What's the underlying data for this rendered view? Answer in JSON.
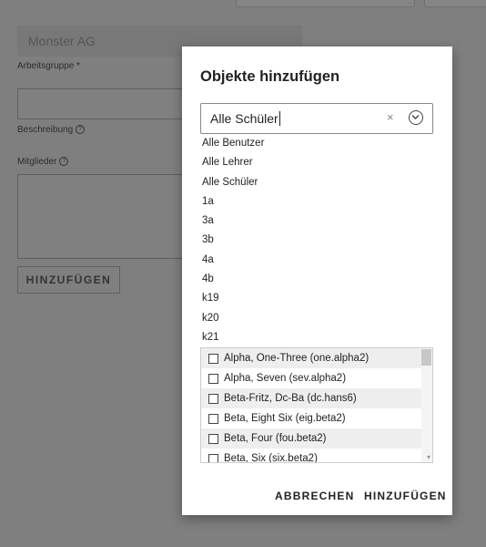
{
  "background_form": {
    "name_value": "Monster AG",
    "workgroup_label": "Arbeitsgruppe *",
    "description_label": "Beschreibung",
    "members_label": "Mitglieder",
    "add_button": "HINZUFÜGEN"
  },
  "dialog": {
    "title": "Objekte hinzufügen",
    "search_value": "Alle Schüler",
    "clear_symbol": "×",
    "options": [
      "Alle Benutzer",
      "Alle Lehrer",
      "Alle Schüler",
      "1a",
      "3a",
      "3b",
      "4a",
      "4b",
      "k19",
      "k20",
      "k21"
    ],
    "members": [
      "Alpha, One-Three (one.alpha2)",
      "Alpha, Seven (sev.alpha2)",
      "Beta-Fritz, Dc-Ba (dc.hans6)",
      "Beta, Eight Six (eig.beta2)",
      "Beta, Four (fou.beta2)",
      "Beta, Six (six.beta2)"
    ],
    "cancel_label": "ABBRECHEN",
    "add_label": "HINZUFÜGEN"
  },
  "colors": {
    "overlay": "#7f7f7f",
    "dialog_bg": "#ffffff",
    "row_alt": "#eeeeee"
  }
}
